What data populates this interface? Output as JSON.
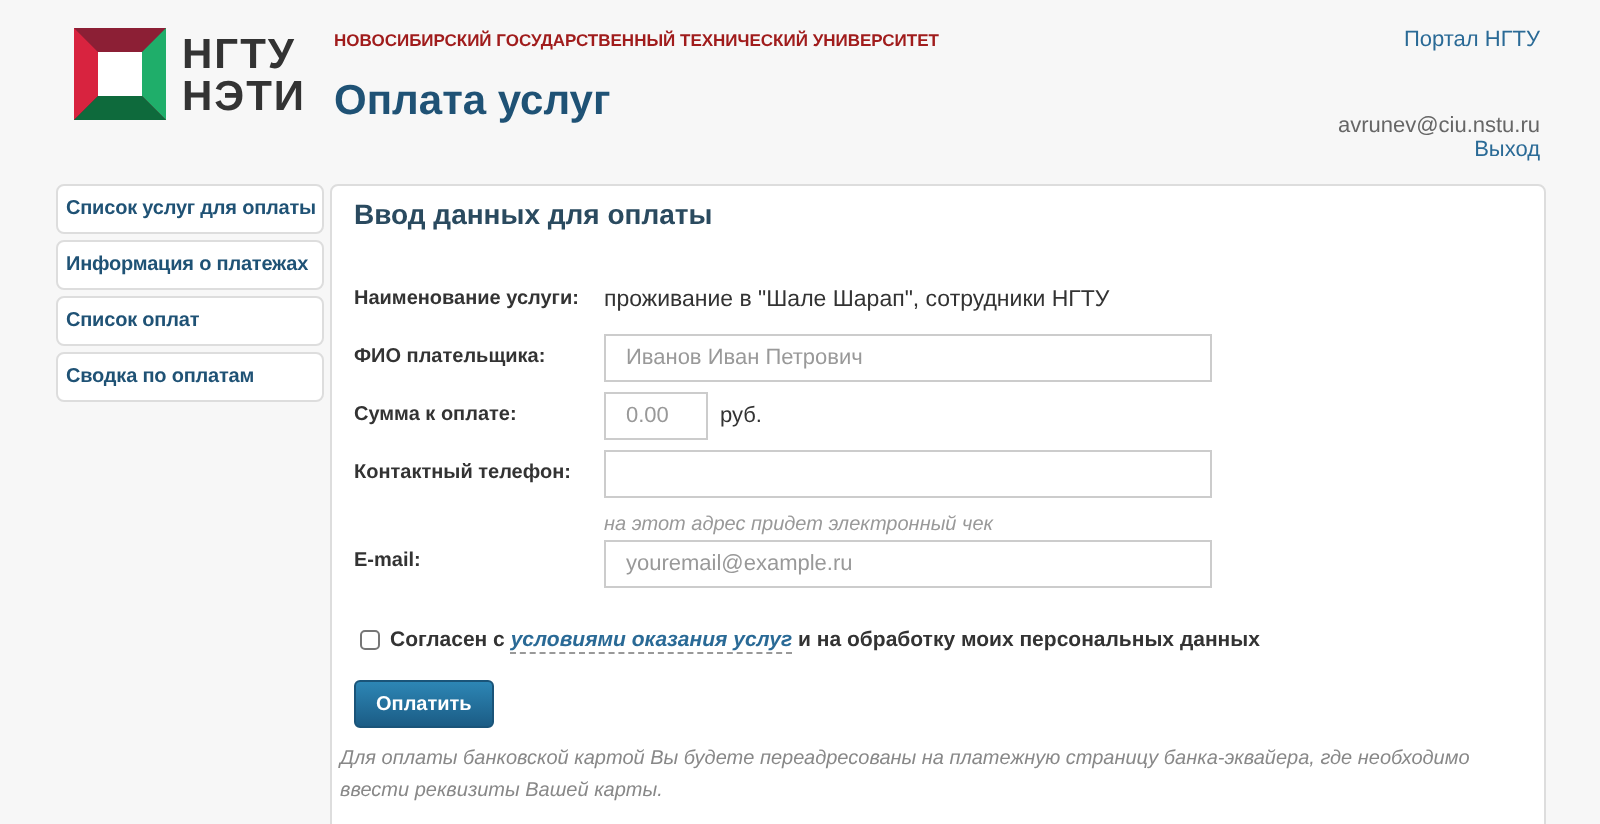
{
  "header": {
    "university": "НОВОСИБИРСКИЙ ГОСУДАРСТВЕННЫЙ ТЕХНИЧЕСКИЙ УНИВЕРСИТЕТ",
    "logo_lines": [
      "НГТУ",
      "НЭТИ"
    ],
    "title": "Оплата услуг",
    "portal_link": "Портал НГТУ",
    "user_email": "avrunev@ciu.nstu.ru",
    "logout": "Выход"
  },
  "sidebar": {
    "items": [
      {
        "label": "Список услуг для оплаты",
        "selected": false
      },
      {
        "label": "Информация о платежах",
        "selected": false
      },
      {
        "label": "Список оплат",
        "selected": false
      },
      {
        "label": "Сводка по оплатам",
        "selected": false
      }
    ]
  },
  "form": {
    "title": "Ввод данных для оплаты",
    "rows": [
      {
        "kind": "static",
        "label": "Наименование услуги:",
        "value": "проживание в \"Шале Шарап\", сотрудники НГТУ"
      },
      {
        "kind": "input",
        "label": "ФИО плательщика:",
        "placeholder": "Иванов Иван Петрович"
      },
      {
        "kind": "amount",
        "label": "Сумма к оплате:",
        "placeholder": "0.00",
        "unit": "руб."
      },
      {
        "kind": "input",
        "label": "Контактный телефон:"
      },
      {
        "kind": "input",
        "label": "E-mail:",
        "hint": "на этот адрес придет электронный чек",
        "placeholder": "youremail@example.ru"
      }
    ],
    "consent": {
      "checked": false,
      "before": "Согласен с",
      "link": "условиями оказания услуг",
      "after": "и на обработку моих персональных данных"
    },
    "submit": "Оплатить",
    "note": "Для оплаты банковской картой Вы будете переадресованы на платежную страницу банка-эквайера, где необходимо ввести реквизиты Вашей карты."
  }
}
